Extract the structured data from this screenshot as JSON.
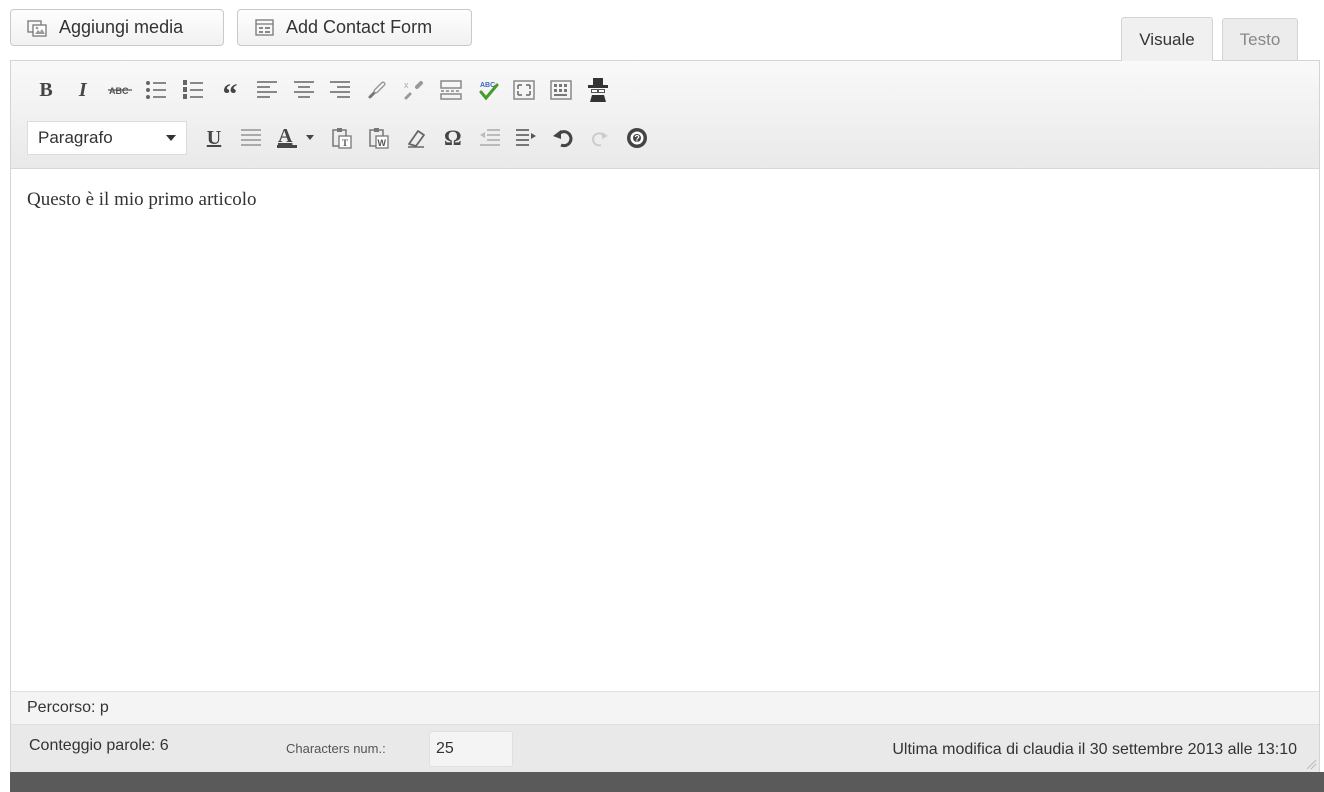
{
  "media_buttons": {
    "add_media": {
      "label": "Aggiungi media",
      "icon": "media-icon"
    },
    "add_contact_form": {
      "label": "Add Contact Form",
      "icon": "form-icon"
    }
  },
  "tabs": {
    "visual": "Visuale",
    "text": "Testo",
    "active": "visual"
  },
  "toolbar": {
    "row1": [
      {
        "name": "bold-icon",
        "glyph": "B"
      },
      {
        "name": "italic-icon",
        "glyph": "I"
      },
      {
        "name": "strikethrough-icon",
        "glyph": "ABC"
      },
      {
        "name": "bullet-list-icon"
      },
      {
        "name": "numbered-list-icon"
      },
      {
        "name": "blockquote-icon",
        "glyph": "“"
      },
      {
        "name": "align-left-icon"
      },
      {
        "name": "align-center-icon"
      },
      {
        "name": "align-right-icon"
      },
      {
        "name": "link-icon"
      },
      {
        "name": "unlink-icon"
      },
      {
        "name": "read-more-icon"
      },
      {
        "name": "spellcheck-icon",
        "glyph": "ABC"
      },
      {
        "name": "fullscreen-icon"
      },
      {
        "name": "kitchen-sink-icon"
      },
      {
        "name": "spy-icon"
      }
    ],
    "format": {
      "selected": "Paragrafo"
    },
    "row2": [
      {
        "name": "underline-icon",
        "glyph": "U"
      },
      {
        "name": "justify-icon"
      },
      {
        "name": "text-color-icon",
        "glyph": "A"
      },
      {
        "name": "paste-text-icon"
      },
      {
        "name": "paste-word-icon"
      },
      {
        "name": "clear-formatting-icon"
      },
      {
        "name": "special-character-icon",
        "glyph": "Ω"
      },
      {
        "name": "outdent-icon"
      },
      {
        "name": "indent-icon"
      },
      {
        "name": "undo-icon"
      },
      {
        "name": "redo-icon"
      },
      {
        "name": "help-icon"
      }
    ]
  },
  "content": {
    "text": "Questo è il mio primo articolo"
  },
  "path": "Percorso: p",
  "status": {
    "word_count": "Conteggio parole: 6",
    "chars_label": "Characters num.:",
    "chars_value": "25",
    "last_edit": "Ultima modifica di claudia il 30 settembre 2013 alle 13:10"
  },
  "colors": {
    "toolbar_top": "#f9f9f9",
    "toolbar_bottom": "#e9e9e9",
    "icon": "#464646",
    "status_bar": "#e9e9e9",
    "bottom_bar": "#5a5a5a"
  }
}
